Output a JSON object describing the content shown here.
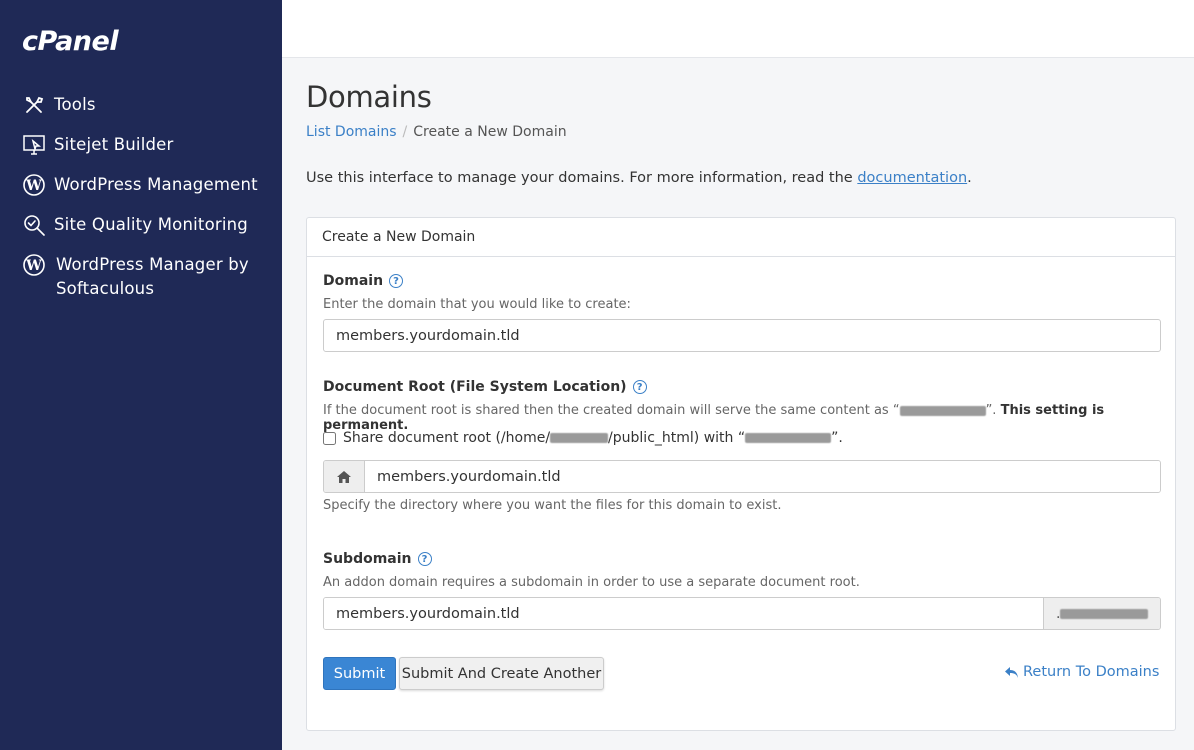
{
  "app": {
    "logo_text": "cPanel"
  },
  "sidebar": {
    "items": [
      {
        "label": "Tools",
        "icon": "tools-icon"
      },
      {
        "label": "Sitejet Builder",
        "icon": "sitejet-icon"
      },
      {
        "label": "WordPress Management",
        "icon": "wordpress-icon"
      },
      {
        "label": "Site Quality Monitoring",
        "icon": "magnifier-check-icon"
      },
      {
        "label": "WordPress Manager by",
        "label2": "Softaculous",
        "icon": "wordpress-icon"
      }
    ]
  },
  "page": {
    "title": "Domains",
    "breadcrumb": {
      "link": "List Domains",
      "current": "Create a New Domain"
    },
    "intro_prefix": "Use this interface to manage your domains. For more information, read the ",
    "intro_link": "documentation",
    "intro_suffix": "."
  },
  "form": {
    "heading": "Create a New Domain",
    "domain": {
      "label": "Domain",
      "help": "Enter the domain that you would like to create:",
      "value": "members.yourdomain.tld"
    },
    "docroot": {
      "label": "Document Root (File System Location)",
      "help_prefix": "If the document root is shared then the created domain will serve the same content as “",
      "help_suffix": "”.",
      "help_strong": "This setting is permanent.",
      "share_prefix": "Share document root (/home/",
      "share_middle": "/public_html) with “",
      "share_suffix": "”.",
      "value": "members.yourdomain.tld",
      "hint": "Specify the directory where you want the files for this domain to exist."
    },
    "subdomain": {
      "label": "Subdomain",
      "help": "An addon domain requires a subdomain in order to use a separate document root.",
      "value": "members.yourdomain.tld",
      "addon_prefix": "."
    },
    "buttons": {
      "submit": "Submit",
      "submit_another": "Submit And Create Another",
      "return": "Return To Domains"
    }
  },
  "colors": {
    "sidebar": "#1f2956",
    "accent": "#3a86d4",
    "link": "#3b80c7"
  }
}
